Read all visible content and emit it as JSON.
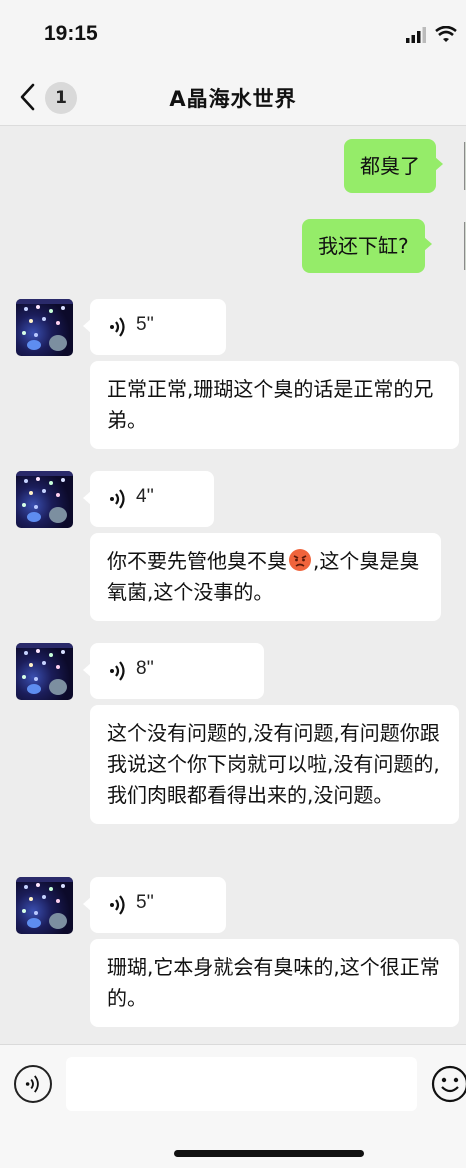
{
  "status_bar": {
    "time": "19:15"
  },
  "nav": {
    "unread_count": "1",
    "title": "A晶海水世界"
  },
  "messages": [
    {
      "side": "out",
      "text": "都臭了"
    },
    {
      "side": "out",
      "text": "我还下缸?"
    },
    {
      "side": "in",
      "type": "voice",
      "duration": "5''",
      "transcript": "正常正常,珊瑚这个臭的话是正常的兄弟。"
    },
    {
      "side": "in",
      "type": "voice",
      "duration": "4''",
      "transcript_before_emoji": "你不要先管他臭不臭",
      "emoji": "angry-face",
      "transcript_after_emoji": ",这个臭是臭氧菌,这个没事的。"
    },
    {
      "side": "in",
      "type": "voice",
      "duration": "8''",
      "transcript": "这个没有问题的,没有问题,有问题你跟我说这个你下岗就可以啦,没有问题的,我们肉眼都看得出来的,没问题。"
    },
    {
      "side": "in",
      "type": "voice",
      "duration": "5''",
      "transcript": "珊瑚,它本身就会有臭味的,这个很正常的。"
    }
  ],
  "input_bar": {
    "placeholder": ""
  },
  "colors": {
    "outgoing_bubble": "#95ec69",
    "incoming_bubble": "#ffffff",
    "background": "#ededed"
  }
}
